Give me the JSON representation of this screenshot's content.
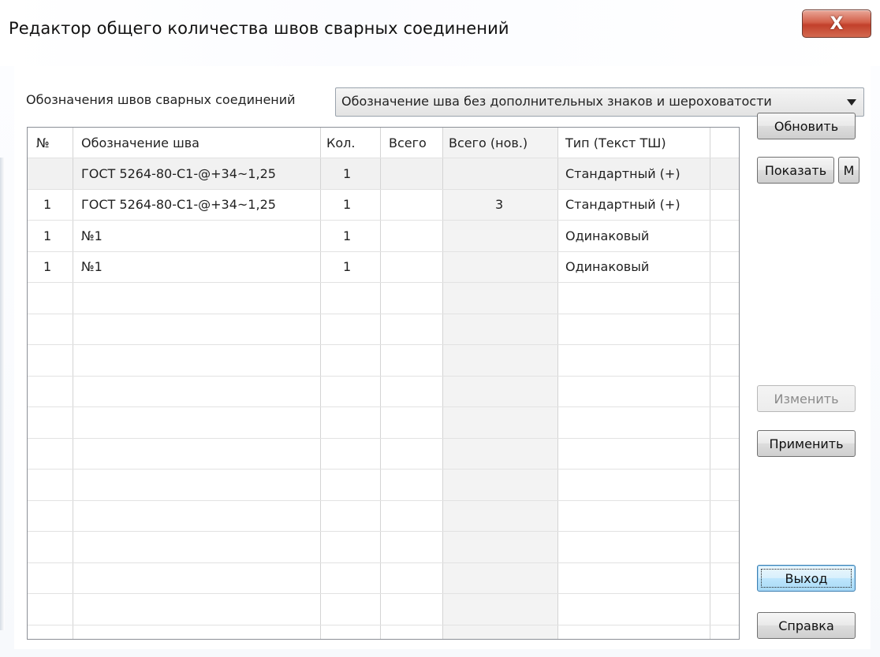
{
  "window": {
    "title": "Редактор общего количества швов сварных соединений",
    "close_glyph": "X",
    "close_icon": "close-icon"
  },
  "filter": {
    "label": "Обозначения швов сварных соединений",
    "selected": "Обозначение шва без дополнительных знаков и шероховатости",
    "arrow_icon": "chevron-down-icon"
  },
  "table": {
    "columns": [
      "№",
      "Обозначение шва",
      "Кол.",
      "Всего",
      "Всего (нов.)",
      "Тип (Текст ТШ)"
    ],
    "rows": [
      {
        "num": "",
        "designation": "ГОСТ 5264-80-С1-@+34~1,25",
        "qty": "1",
        "total": "",
        "total_new": "",
        "type": "Стандартный (+)"
      },
      {
        "num": "1",
        "designation": "ГОСТ 5264-80-С1-@+34~1,25",
        "qty": "1",
        "total": "",
        "total_new": "3",
        "type": "Стандартный (+)"
      },
      {
        "num": "1",
        "designation": "№1",
        "qty": "1",
        "total": "",
        "total_new": "",
        "type": "Одинаковый"
      },
      {
        "num": "1",
        "designation": "№1",
        "qty": "1",
        "total": "",
        "total_new": "",
        "type": "Одинаковый"
      }
    ]
  },
  "buttons": {
    "refresh": "Обновить",
    "show": "Показать",
    "m": "М",
    "edit": "Изменить",
    "apply": "Применить",
    "exit": "Выход",
    "help": "Справка"
  },
  "colors": {
    "selected_row": "#f1f1f1",
    "shaded_column": "#f3f3f3",
    "close_button": "#c9442e"
  }
}
